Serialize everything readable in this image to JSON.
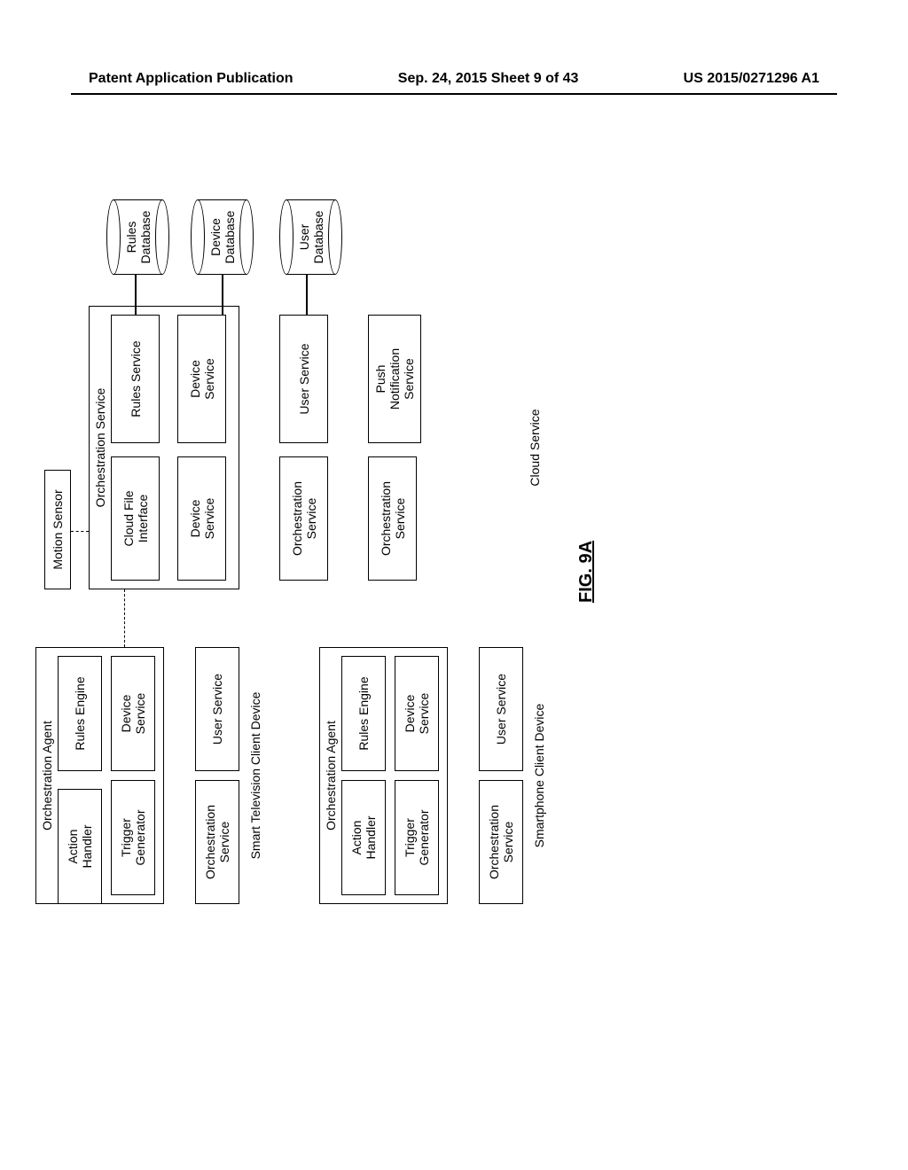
{
  "header": {
    "left": "Patent Application Publication",
    "center": "Sep. 24, 2015  Sheet 9 of 43",
    "right": "US 2015/0271296 A1"
  },
  "figure_label": "FIG. 9A",
  "tv_client": {
    "container_label": "Smart Television Client Device",
    "agent_label": "Orchestration Agent",
    "action_handler": "Action\nHandler",
    "rules_engine": "Rules Engine",
    "trigger_gen": "Trigger\nGenerator",
    "device_service": "Device\nService",
    "orch_service": "Orchestration\nService",
    "user_service": "User Service"
  },
  "phone_client": {
    "container_label": "Smartphone Client Device",
    "agent_label": "Orchestration Agent",
    "action_handler": "Action\nHandler",
    "rules_engine": "Rules Engine",
    "trigger_gen": "Trigger\nGenerator",
    "device_service": "Device\nService",
    "orch_service": "Orchestration\nService",
    "user_service": "User Service"
  },
  "cloud": {
    "container_label": "Cloud Service",
    "service_label": "Orchestration Service",
    "cloud_file": "Cloud File\nInterface",
    "rules_service": "Rules Service",
    "device_service_l": "Device\nService",
    "device_service_r": "Device\nService",
    "orch_service1": "Orchestration\nService",
    "user_service": "User Service",
    "orch_service2": "Orchestration\nService",
    "push_notif": "Push\nNotification\nService"
  },
  "motion_sensor": "Motion Sensor",
  "databases": {
    "rules": "Rules\nDatabase",
    "device": "Device\nDatabase",
    "user": "User\nDatabase"
  }
}
